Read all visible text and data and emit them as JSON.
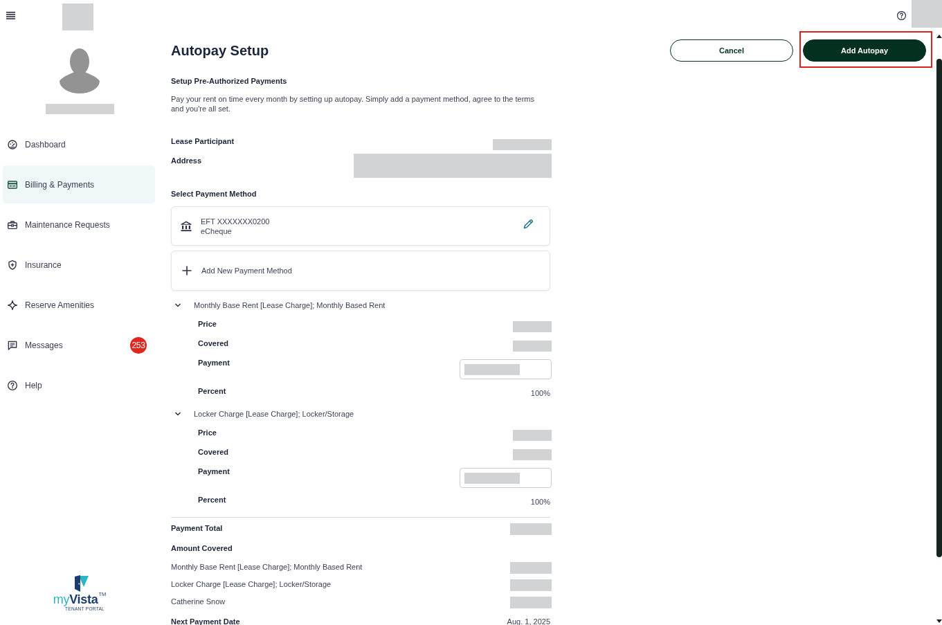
{
  "sidebar": {
    "items": [
      {
        "label": "Dashboard",
        "selected": false
      },
      {
        "label": "Billing & Payments",
        "selected": true
      },
      {
        "label": "Maintenance Requests",
        "selected": false
      },
      {
        "label": "Insurance",
        "selected": false
      },
      {
        "label": "Reserve Amenities",
        "selected": false
      },
      {
        "label": "Messages",
        "selected": false,
        "badge": "253"
      },
      {
        "label": "Help",
        "selected": false
      }
    ],
    "logo": {
      "wordmark_parts": [
        {
          "text": "my",
          "color": "#2cb5c2"
        },
        {
          "text": "Vista",
          "color": "#1d3c6e"
        }
      ],
      "trademark": "TM",
      "tagline": "TENANT PORTAL"
    }
  },
  "header": {
    "title": "Autopay Setup",
    "buttons": [
      {
        "label": "Cancel",
        "kind": "secondary",
        "highlighted": false
      },
      {
        "label": "Add Autopay",
        "kind": "primary",
        "highlighted": true
      }
    ]
  },
  "intro": {
    "heading": "Setup Pre-Authorized Payments",
    "text": "Pay your rent on time every month by setting up autopay. Simply add a payment method, agree to the terms and you're all set."
  },
  "details": [
    {
      "label": "Lease Participant",
      "value": {
        "kind": "redacted"
      }
    },
    {
      "label": "Address",
      "value": {
        "kind": "redacted_multiline"
      }
    }
  ],
  "payment_methods": {
    "heading": "Select Payment Method",
    "items": [
      {
        "kind": "saved",
        "title": "EFT XXXXXXX0200",
        "subtitle": "eCheque"
      },
      {
        "kind": "add",
        "label": "Add New Payment Method"
      }
    ]
  },
  "charges": [
    {
      "title": "Monthly Base Rent [Lease Charge]; Monthly Based Rent",
      "expanded": true,
      "rows": [
        {
          "label": "Price",
          "value": {
            "kind": "redacted"
          }
        },
        {
          "label": "Covered",
          "value": {
            "kind": "redacted"
          }
        },
        {
          "label": "Payment",
          "value": {
            "kind": "input"
          }
        },
        {
          "label": "Percent",
          "value": {
            "kind": "text",
            "text": "100%"
          }
        }
      ]
    },
    {
      "title": "Locker Charge [Lease Charge]; Locker/Storage",
      "expanded": true,
      "rows": [
        {
          "label": "Price",
          "value": {
            "kind": "redacted"
          }
        },
        {
          "label": "Covered",
          "value": {
            "kind": "redacted"
          }
        },
        {
          "label": "Payment",
          "value": {
            "kind": "input"
          }
        },
        {
          "label": "Percent",
          "value": {
            "kind": "text",
            "text": "100%"
          }
        }
      ]
    }
  ],
  "summary": {
    "rows": [
      {
        "label": "Payment Total",
        "bold": true,
        "value": {
          "kind": "redacted"
        }
      },
      {
        "label": "Amount Covered",
        "bold": true
      },
      {
        "label": "Monthly Base Rent [Lease Charge]; Monthly Based Rent",
        "bold": false,
        "value": {
          "kind": "redacted"
        }
      },
      {
        "label": "Locker Charge [Lease Charge]; Locker/Storage",
        "bold": false,
        "value": {
          "kind": "redacted"
        }
      },
      {
        "label": "Catherine Snow",
        "bold": false,
        "value": {
          "kind": "redacted"
        }
      },
      {
        "label": "Next Payment Date",
        "bold": true,
        "value": {
          "kind": "text",
          "text": "Aug. 1, 2025"
        }
      }
    ]
  }
}
